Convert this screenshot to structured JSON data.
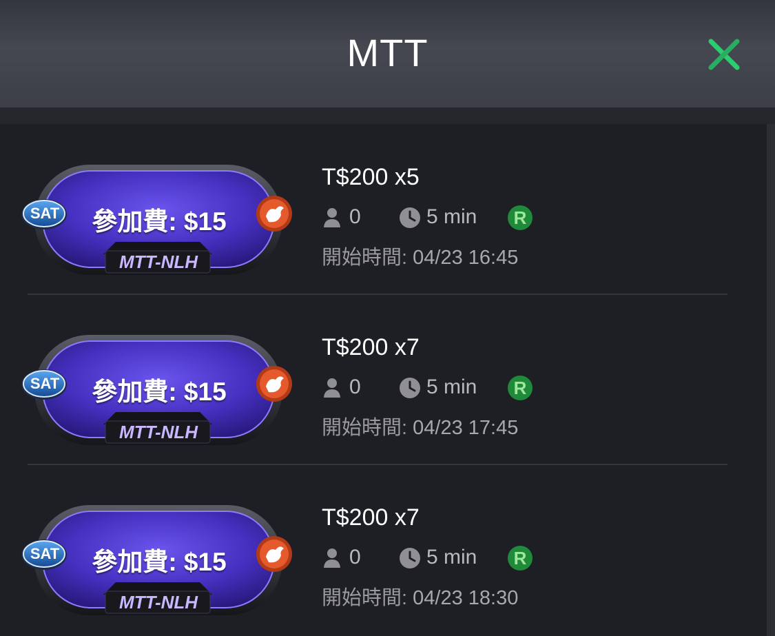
{
  "header": {
    "title": "MTT",
    "close_icon": "close-x-icon",
    "accent": "#2ecc71"
  },
  "tournaments": [
    {
      "tag": "SAT",
      "fee": "參加費: $15",
      "game_type": "MTT-NLH",
      "prize": "T$200 x5",
      "players": "0",
      "duration": "5 min",
      "rebuy_badge": "R",
      "start_label": "開始時間:",
      "start_time": "04/23 16:45"
    },
    {
      "tag": "SAT",
      "fee": "參加費: $15",
      "game_type": "MTT-NLH",
      "prize": "T$200 x7",
      "players": "0",
      "duration": "5 min",
      "rebuy_badge": "R",
      "start_label": "開始時間:",
      "start_time": "04/23 17:45"
    },
    {
      "tag": "SAT",
      "fee": "參加費: $15",
      "game_type": "MTT-NLH",
      "prize": "T$200 x7",
      "players": "0",
      "duration": "5 min",
      "rebuy_badge": "R",
      "start_label": "開始時間:",
      "start_time": "04/23 18:30"
    }
  ],
  "colors": {
    "badge_purple": "#4a32c8",
    "rebuy_green": "#1f8a3a",
    "tag_blue": "#1f6fc0",
    "bird_badge": "#e0532a"
  }
}
